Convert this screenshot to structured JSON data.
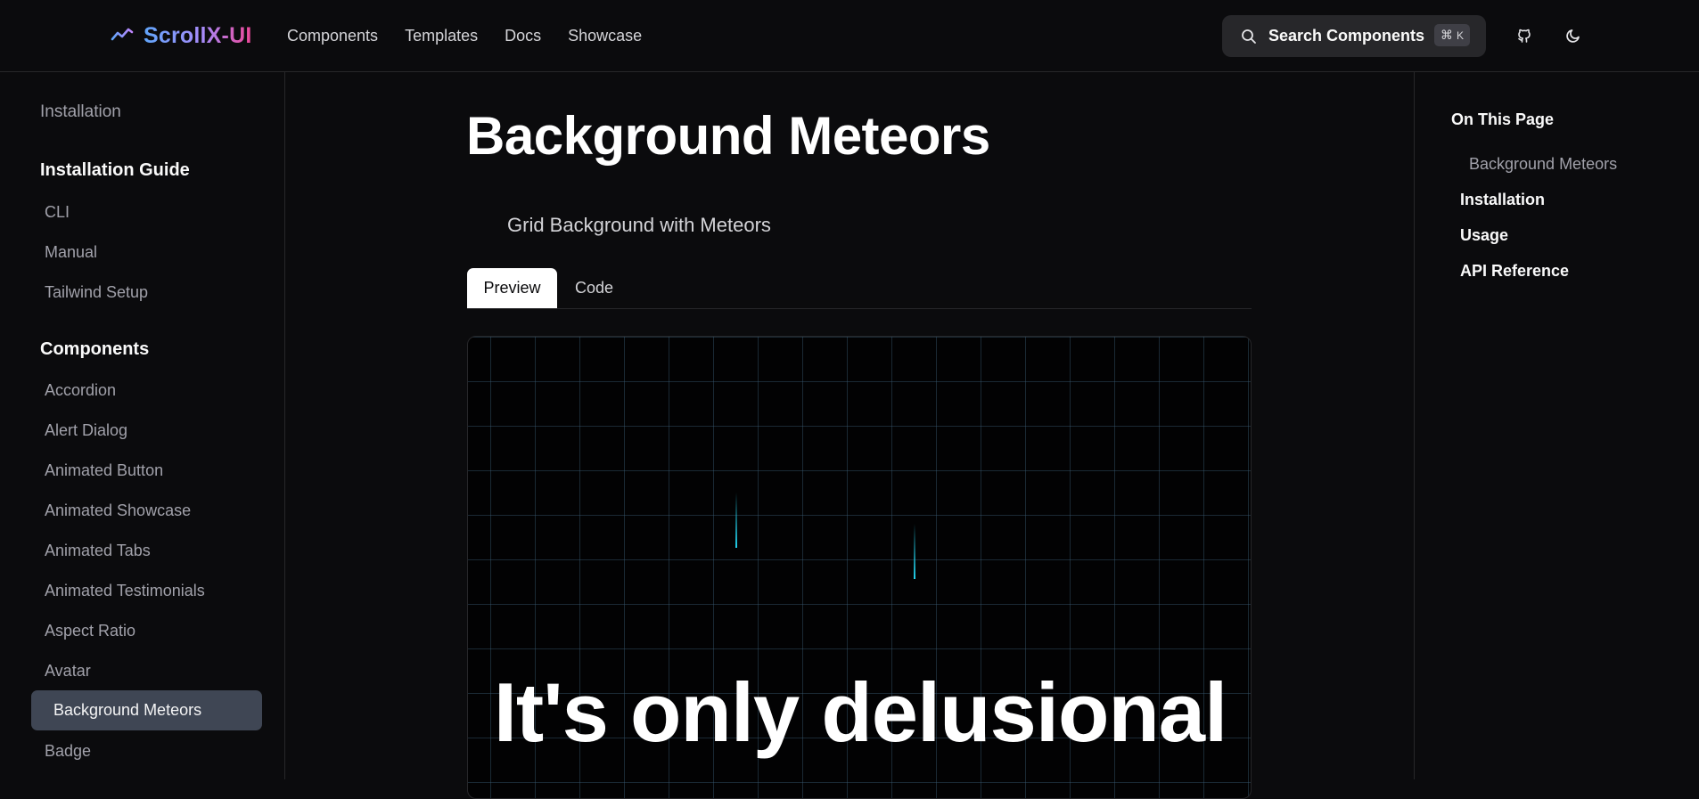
{
  "header": {
    "logo_text": "ScrollX-UI",
    "nav": [
      "Components",
      "Templates",
      "Docs",
      "Showcase"
    ],
    "search": {
      "label": "Search Components",
      "shortcut_symbol": "⌘",
      "shortcut_key": "K"
    }
  },
  "sidebar": {
    "install_link": "Installation",
    "guide_heading": "Installation Guide",
    "guide_items": [
      "CLI",
      "Manual",
      "Tailwind Setup"
    ],
    "components_heading": "Components",
    "component_items": [
      "Accordion",
      "Alert Dialog",
      "Animated Button",
      "Animated Showcase",
      "Animated Tabs",
      "Animated Testimonials",
      "Aspect Ratio",
      "Avatar"
    ],
    "active_item": "Background Meteors",
    "after_active": [
      "Badge"
    ]
  },
  "main": {
    "title": "Background Meteors",
    "subtitle": "Grid Background with Meteors",
    "tabs": {
      "preview": "Preview",
      "code": "Code"
    },
    "preview_text": "It's only delusional"
  },
  "toc": {
    "title": "On This Page",
    "sub_item": "Background Meteors",
    "items": [
      "Installation",
      "Usage",
      "API Reference"
    ]
  },
  "colors": {
    "background": "#0b0b0d",
    "accent_gradient_start": "#60a5fa",
    "accent_gradient_end": "#ec4899",
    "active_item_bg": "#3f4654",
    "meteor": "#22d3ee"
  }
}
